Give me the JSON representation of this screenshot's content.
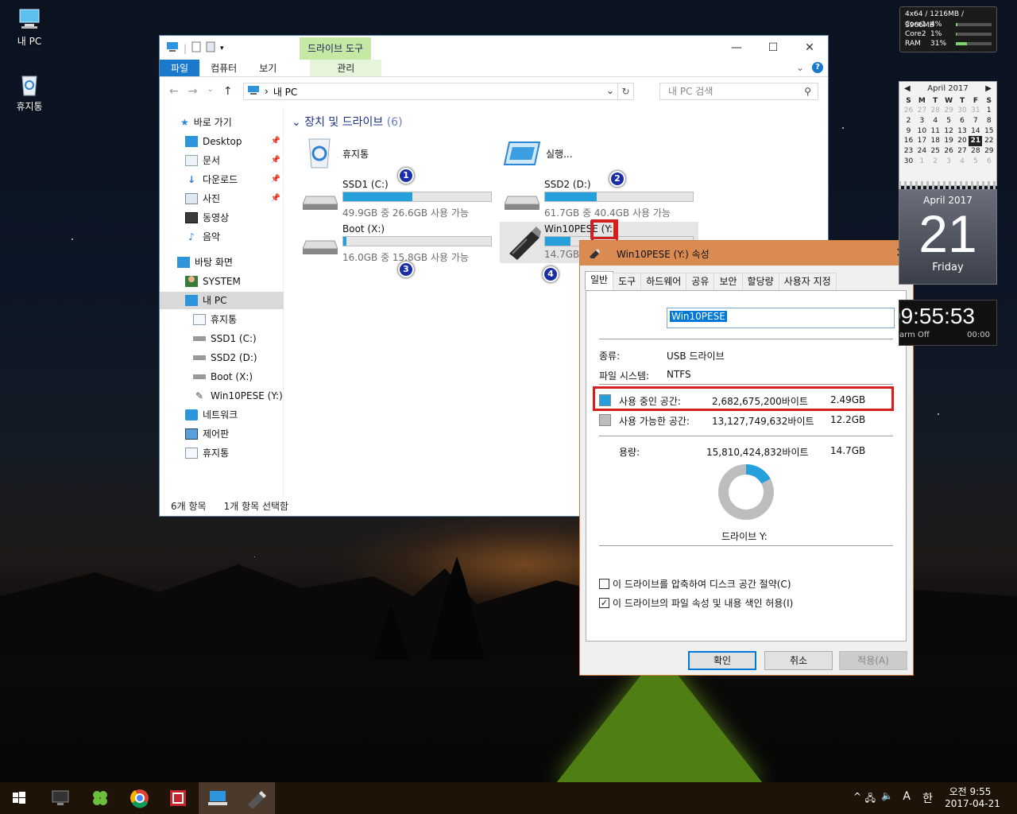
{
  "desktop": {
    "icons": [
      {
        "label": "내 PC"
      },
      {
        "label": "휴지통"
      }
    ]
  },
  "explorer": {
    "context_tab": "드라이브 도구",
    "ribbon_tabs": [
      "파일",
      "컴퓨터",
      "보기"
    ],
    "ribbon_context": "관리",
    "address": "내 PC",
    "search_placeholder": "내 PC 검색",
    "nav": {
      "quick": "바로 가기",
      "items": [
        "Desktop",
        "문서",
        "다운로드",
        "사진",
        "동영상",
        "음악"
      ],
      "desktop": "바탕 화면",
      "system": "SYSTEM",
      "thispc": "내 PC",
      "sub": [
        "휴지통",
        "SSD1 (C:)",
        "SSD2 (D:)",
        "Boot (X:)",
        "Win10PESE (Y:)"
      ],
      "network": "네트워크",
      "control": "제어판",
      "recycle": "휴지통"
    },
    "group": {
      "title": "장치 및 드라이브",
      "count": "(6)"
    },
    "tiles": {
      "recycle": "휴지통",
      "run": "실행...",
      "drives": [
        {
          "name": "SSD1 (C:)",
          "free": "49.9GB 중 26.6GB 사용 가능",
          "used_fraction": 0.47,
          "badge": "1"
        },
        {
          "name": "SSD2 (D:)",
          "free": "61.7GB 중 40.4GB 사용 가능",
          "used_fraction": 0.35,
          "badge": "2"
        },
        {
          "name": "Boot (X:)",
          "free": "16.0GB 중 15.8GB 사용 가능",
          "used_fraction": 0.02,
          "badge": "3"
        },
        {
          "name": "Win10PESE (Y:)",
          "free": "14.7GB",
          "used_fraction": 0.17,
          "badge": "4"
        }
      ]
    },
    "status": {
      "items": "6개 항목",
      "selected": "1개 항목 선택함"
    }
  },
  "dialog": {
    "title": "Win10PESE (Y:) 속성",
    "tabs": [
      "일반",
      "도구",
      "하드웨어",
      "공유",
      "보안",
      "할당량",
      "사용자 지정"
    ],
    "name": "Win10PESE",
    "type_label": "종류:",
    "type_value": "USB 드라이브",
    "fs_label": "파일 시스템:",
    "fs_value": "NTFS",
    "used_label": "사용 중인 공간:",
    "used_bytes": "2,682,675,200바이트",
    "used_gb": "2.49GB",
    "free_label": "사용 가능한 공간:",
    "free_bytes": "13,127,749,632바이트",
    "free_gb": "12.2GB",
    "cap_label": "용량:",
    "cap_bytes": "15,810,424,832바이트",
    "cap_gb": "14.7GB",
    "drive_caption": "드라이브 Y:",
    "compress": "이 드라이브를 압축하여 디스크 공간 절약(C)",
    "index": "이 드라이브의 파일 속성 및 내용 색인 허용(I)",
    "ok": "확인",
    "cancel": "취소",
    "apply": "적용(A)",
    "used_color": "#26a0da",
    "free_color": "#bdbdbd"
  },
  "gadgets": {
    "meter": {
      "head": "4x64 / 1216MB / 3966MB",
      "rows": [
        {
          "label": "Core1",
          "value": "4%"
        },
        {
          "label": "Core2",
          "value": "1%"
        },
        {
          "label": "RAM",
          "value": "31%"
        }
      ]
    },
    "calendar": {
      "month": "April 2017",
      "days": [
        "S",
        "M",
        "T",
        "W",
        "T",
        "F",
        "S"
      ],
      "weeks": [
        [
          "26",
          "27",
          "28",
          "29",
          "30",
          "31",
          "1"
        ],
        [
          "2",
          "3",
          "4",
          "5",
          "6",
          "7",
          "8"
        ],
        [
          "9",
          "10",
          "11",
          "12",
          "13",
          "14",
          "15"
        ],
        [
          "16",
          "17",
          "18",
          "19",
          "20",
          "21",
          "22"
        ],
        [
          "23",
          "24",
          "25",
          "26",
          "27",
          "28",
          "29"
        ],
        [
          "30",
          "1",
          "2",
          "3",
          "4",
          "5",
          "6"
        ]
      ]
    },
    "bigdate": {
      "month": "April 2017",
      "day": "21",
      "weekday": "Friday"
    },
    "clock": {
      "time": "09:55:53",
      "alarm": "arm Off",
      "timer": "00:00"
    }
  },
  "taskbar": {
    "time": "오전 9:55",
    "date": "2017-04-21",
    "ime": "한"
  }
}
